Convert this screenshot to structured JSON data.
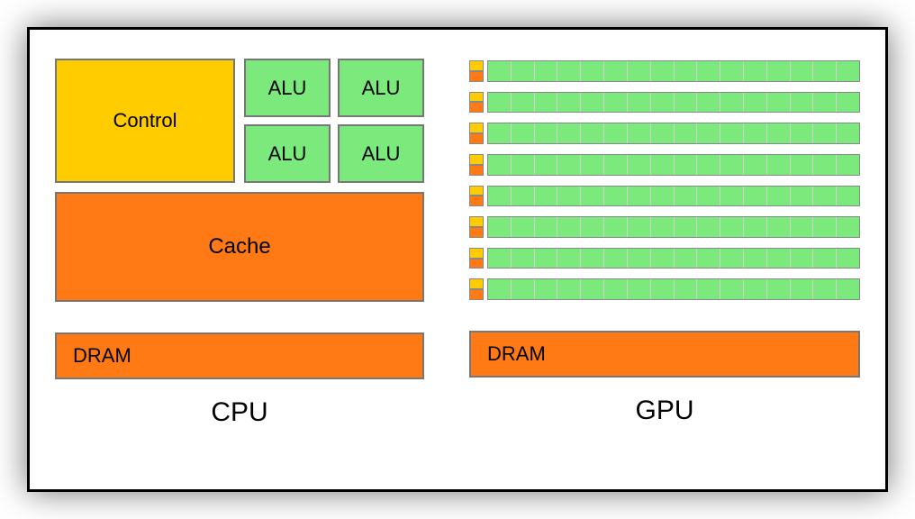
{
  "cpu": {
    "control": "Control",
    "alu": "ALU",
    "cache": "Cache",
    "dram": "DRAM",
    "title": "CPU"
  },
  "gpu": {
    "dram": "DRAM",
    "title": "GPU",
    "rows": 8,
    "cores_per_row": 16
  },
  "colors": {
    "control": "#ffcc00",
    "alu": "#7CE97C",
    "cache": "#ff7a14",
    "dram": "#ff7a14"
  }
}
